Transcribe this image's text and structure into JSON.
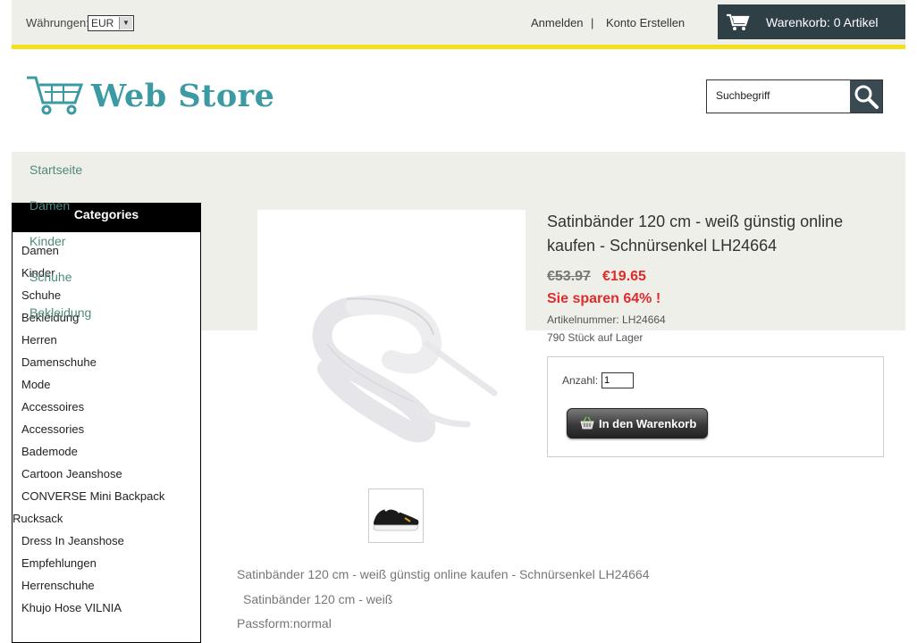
{
  "topbar": {
    "currency_label": "Währungen:",
    "currency_value": "EUR",
    "login": "Anmelden",
    "separator": "|",
    "register": "Konto Erstellen",
    "cart_text": "Warenkorb:  0  Artikel"
  },
  "header": {
    "logo_text": "Web Store",
    "search_placeholder": "Suchbegriff"
  },
  "nav": {
    "items": [
      "Startseite",
      "Damen",
      "Kinder",
      "Schuhe",
      "Bekleidung"
    ]
  },
  "categories": {
    "title": "Categories",
    "items": [
      "Damen",
      "Kinder",
      "Schuhe",
      "Bekleidung",
      "Herren",
      "Damenschuhe",
      "Mode",
      "Accessoires",
      "Accessories",
      "Bademode",
      "Cartoon Jeanshose",
      "CONVERSE Mini Backpack",
      "Rucksack",
      "Dress In Jeanshose",
      "Empfehlungen",
      "Herrenschuhe",
      "Khujo Hose VILNIA"
    ]
  },
  "product": {
    "title": "Satinbänder 120 cm - weiß günstig online kaufen - Schnürsenkel LH24664",
    "old_price": "€53.97 ",
    "new_price": "€19.65",
    "savings": "Sie sparen 64% !",
    "sku": "Artikelnummer: LH24664",
    "stock": "790 Stück auf Lager",
    "qty_label": "Anzahl:",
    "qty_value": "1",
    "add_to_cart": "In den Warenkorb"
  },
  "description": {
    "line1": "Satinbänder 120 cm - weiß günstig online kaufen - Schnürsenkel LH24664",
    "line2": "Satinbänder 120 cm - weiß",
    "line3": "Passform:normal"
  },
  "colors": {
    "accent_yellow": "#f2e21a",
    "cart_bg": "#2e3f46",
    "logo_teal": "#3b9aa3",
    "nav_text": "#4e8a7c",
    "price_red": "#e02b2b"
  }
}
